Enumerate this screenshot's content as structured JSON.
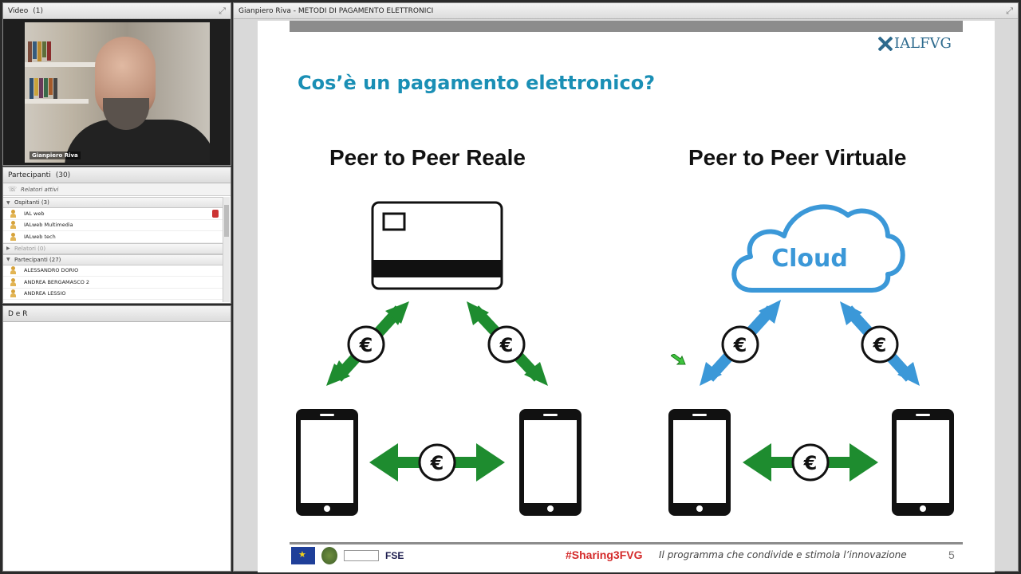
{
  "video_pod": {
    "title": "Video",
    "count": "(1)",
    "camera_name": "Gianpiero Riva"
  },
  "participants_pod": {
    "title": "Partecipanti",
    "count": "(30)",
    "active_speakers_label": "Relatori attivi",
    "groups": [
      {
        "label": "Ospitanti (3)",
        "expanded": true,
        "members": [
          "IAL web",
          "IALweb Multimedia",
          "IALweb tech"
        ]
      },
      {
        "label": "Relatori (0)",
        "expanded": false,
        "members": []
      },
      {
        "label": "Partecipanti (27)",
        "expanded": true,
        "members": [
          "ALESSANDRO DORIO",
          "ANDREA BERGAMASCO 2",
          "ANDREA LESSIO"
        ]
      }
    ]
  },
  "notes_pod": {
    "title": "D e R"
  },
  "share_pod": {
    "title": "Gianpiero Riva - METODI DI PAGAMENTO ELETTRONICI"
  },
  "slide": {
    "logo": "IALFVG",
    "title": "Cos’è un pagamento elettronico?",
    "left_heading": "Peer to Peer Reale",
    "right_heading": "Peer to Peer Virtuale",
    "cloud_label": "Cloud",
    "euro_symbol": "€",
    "footer_hashtag": "#Sharing3FVG",
    "footer_tagline": "Il programma che condivide e stimola l’innovazione",
    "page_number": "5",
    "fse_label": "FSE"
  },
  "colors": {
    "green_arrow": "#1e8c2f",
    "blue_arrow": "#3b98d8",
    "title_blue": "#1a8fb5",
    "hashtag_red": "#d42a2a"
  }
}
